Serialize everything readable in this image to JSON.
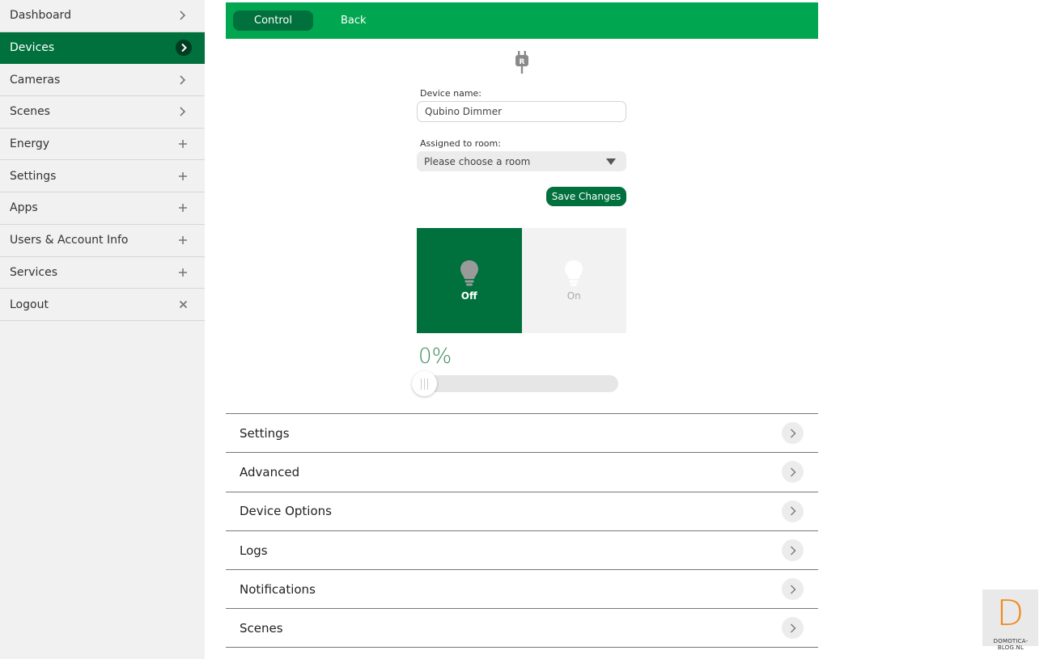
{
  "sidebar": {
    "items": [
      {
        "label": "Dashboard",
        "icon": "chevron-right-icon"
      },
      {
        "label": "Devices",
        "icon": "chevron-right-icon",
        "active": true
      },
      {
        "label": "Cameras",
        "icon": "chevron-right-icon"
      },
      {
        "label": "Scenes",
        "icon": "chevron-right-icon"
      },
      {
        "label": "Energy",
        "icon": "plus-icon"
      },
      {
        "label": "Settings",
        "icon": "plus-icon"
      },
      {
        "label": "Apps",
        "icon": "plus-icon"
      },
      {
        "label": "Users & Account Info",
        "icon": "plus-icon"
      },
      {
        "label": "Services",
        "icon": "plus-icon"
      },
      {
        "label": "Logout",
        "icon": "close-icon"
      }
    ]
  },
  "topbar": {
    "control_label": "Control",
    "back_label": "Back"
  },
  "device": {
    "icon": "plug-icon",
    "name_label": "Device name:",
    "name_value": "Qubino Dimmer",
    "room_label": "Assigned to room:",
    "room_placeholder": "Please choose a room",
    "save_label": "Save Changes"
  },
  "switch": {
    "off_label": "Off",
    "on_label": "On",
    "state": "off"
  },
  "dimmer": {
    "value_text": "0%",
    "value": 0
  },
  "accordion": [
    {
      "label": "Settings"
    },
    {
      "label": "Advanced"
    },
    {
      "label": "Device Options"
    },
    {
      "label": "Logs"
    },
    {
      "label": "Notifications"
    },
    {
      "label": "Scenes"
    }
  ],
  "watermark": {
    "glyph": "D",
    "text": "DOMOTICA-BLOG.NL"
  },
  "colors": {
    "accent": "#00a650",
    "accent_dark": "#00703c",
    "logo_orange": "#f08a1c"
  }
}
